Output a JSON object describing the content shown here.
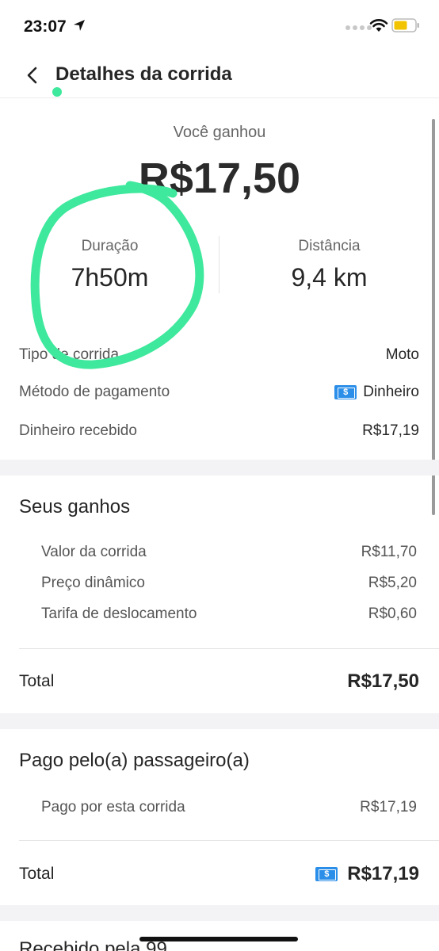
{
  "status_bar": {
    "time": "23:07"
  },
  "header": {
    "title": "Detalhes da corrida"
  },
  "summary": {
    "earned_label": "Você ganhou",
    "earned_value": "R$17,50",
    "duration_label": "Duração",
    "duration_value": "7h50m",
    "distance_label": "Distância",
    "distance_value": "9,4 km"
  },
  "details": [
    {
      "label": "Tipo de corrida",
      "value": "Moto"
    },
    {
      "label": "Método de pagamento",
      "value": "Dinheiro",
      "icon": "cash-icon"
    },
    {
      "label": "Dinheiro recebido",
      "value": "R$17,19"
    }
  ],
  "earnings": {
    "title": "Seus ganhos",
    "items": [
      {
        "label": "Valor da corrida",
        "value": "R$11,70"
      },
      {
        "label": "Preço dinâmico",
        "value": "R$5,20"
      },
      {
        "label": "Tarifa de deslocamento",
        "value": "R$0,60"
      }
    ],
    "total_label": "Total",
    "total_value": "R$17,50"
  },
  "passenger": {
    "title": "Pago pelo(a) passageiro(a)",
    "items": [
      {
        "label": "Pago por esta corrida",
        "value": "R$17,19"
      }
    ],
    "total_label": "Total",
    "total_value": "R$17,19",
    "total_icon": "cash-icon"
  },
  "next_section": {
    "title": "Recebido pela 99"
  },
  "colors": {
    "annotation": "#3ee89c",
    "cash_icon": "#2b8ee8",
    "section_gap": "#f3f3f5"
  }
}
